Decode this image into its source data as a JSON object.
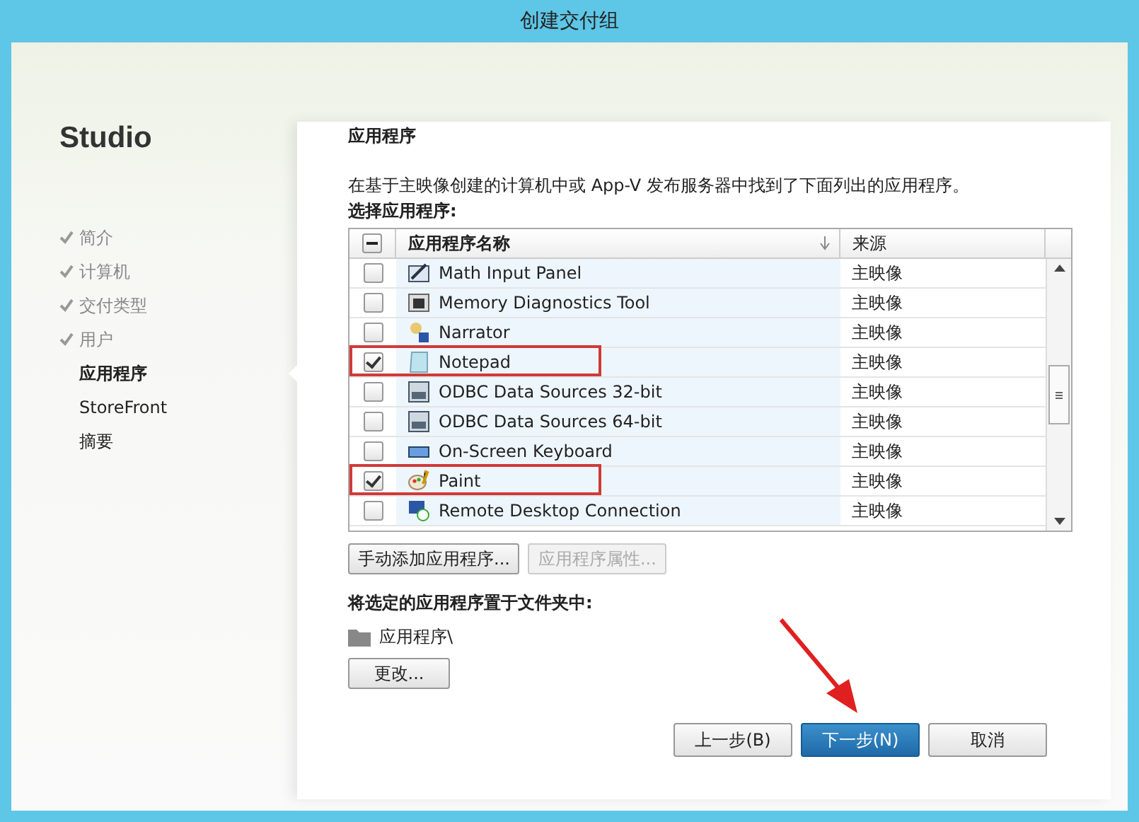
{
  "window": {
    "title": "创建交付组"
  },
  "sidebar": {
    "brand": "Studio",
    "steps": [
      {
        "label": "简介",
        "done": true,
        "selected": false
      },
      {
        "label": "计算机",
        "done": true,
        "selected": false
      },
      {
        "label": "交付类型",
        "done": true,
        "selected": false
      },
      {
        "label": "用户",
        "done": true,
        "selected": false
      },
      {
        "label": "应用程序",
        "done": false,
        "selected": true
      },
      {
        "label": "StoreFront",
        "done": false,
        "selected": false
      },
      {
        "label": "摘要",
        "done": false,
        "selected": false
      }
    ]
  },
  "page": {
    "heading": "应用程序",
    "intro": "在基于主映像创建的计算机中或 App-V 发布服务器中找到了下面列出的应用程序。",
    "select_label": "选择应用程序:"
  },
  "table": {
    "select_all_partial": true,
    "columns": [
      "应用程序名称",
      "来源"
    ],
    "rows": [
      {
        "name": "Math Input Panel",
        "source": "主映像",
        "checked": false,
        "highlighted": false
      },
      {
        "name": "Memory Diagnostics Tool",
        "source": "主映像",
        "checked": false,
        "highlighted": false
      },
      {
        "name": "Narrator",
        "source": "主映像",
        "checked": false,
        "highlighted": false
      },
      {
        "name": "Notepad",
        "source": "主映像",
        "checked": true,
        "highlighted": true
      },
      {
        "name": "ODBC Data Sources 32-bit",
        "source": "主映像",
        "checked": false,
        "highlighted": false
      },
      {
        "name": "ODBC Data Sources 64-bit",
        "source": "主映像",
        "checked": false,
        "highlighted": false
      },
      {
        "name": "On-Screen Keyboard",
        "source": "主映像",
        "checked": false,
        "highlighted": false
      },
      {
        "name": "Paint",
        "source": "主映像",
        "checked": true,
        "highlighted": true
      },
      {
        "name": "Remote Desktop Connection",
        "source": "主映像",
        "checked": false,
        "highlighted": false
      }
    ]
  },
  "list_buttons": [
    {
      "label": "手动添加应用程序...",
      "disabled": false
    },
    {
      "label": "应用程序属性...",
      "disabled": true
    }
  ],
  "folder": {
    "label": "将选定的应用程序置于文件夹中:",
    "path": "应用程序\\",
    "change_button": "更改..."
  },
  "footer_buttons": [
    {
      "label": "上一步(B)",
      "primary": false
    },
    {
      "label": "下一步(N)",
      "primary": true
    },
    {
      "label": "取消",
      "primary": false
    }
  ]
}
